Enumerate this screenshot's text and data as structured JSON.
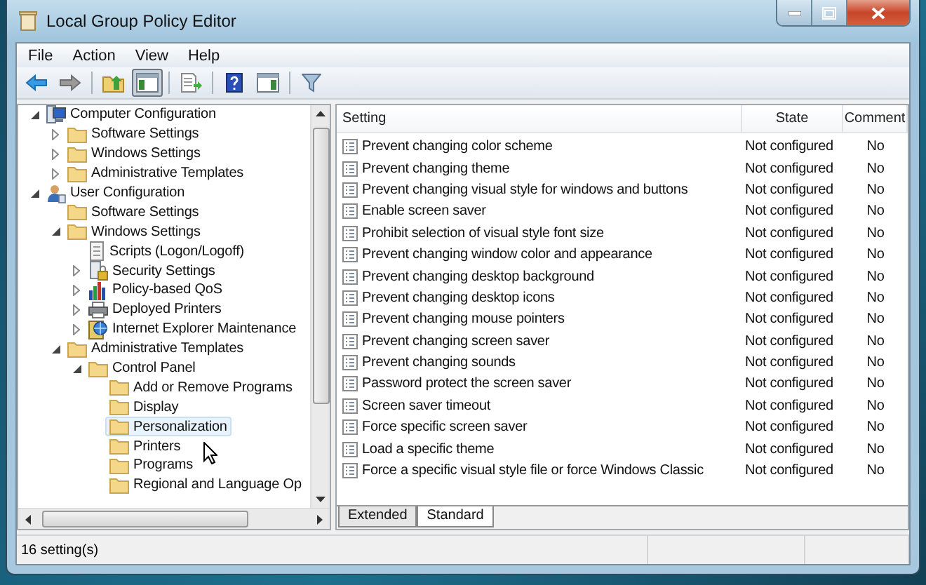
{
  "window": {
    "title": "Local Group Policy Editor"
  },
  "menu": [
    "File",
    "Action",
    "View",
    "Help"
  ],
  "toolbar": [
    {
      "kind": "back",
      "pressed": false
    },
    {
      "kind": "forward",
      "pressed": false
    },
    {
      "kind": "sep"
    },
    {
      "kind": "up",
      "pressed": false
    },
    {
      "kind": "tree",
      "pressed": true
    },
    {
      "kind": "sep"
    },
    {
      "kind": "export",
      "pressed": false
    },
    {
      "kind": "sep"
    },
    {
      "kind": "help",
      "pressed": false
    },
    {
      "kind": "pane",
      "pressed": false
    },
    {
      "kind": "sep"
    },
    {
      "kind": "filter",
      "pressed": false
    }
  ],
  "tree": [
    {
      "label": "Computer Configuration",
      "kind": "computer",
      "expanded": true,
      "selected": false,
      "children": [
        {
          "label": "Software Settings",
          "kind": "folder",
          "expanded": false,
          "selected": false
        },
        {
          "label": "Windows Settings",
          "kind": "folder",
          "expanded": false,
          "selected": false
        },
        {
          "label": "Administrative Templates",
          "kind": "folder",
          "expanded": false,
          "selected": false
        }
      ]
    },
    {
      "label": "User Configuration",
      "kind": "user",
      "expanded": true,
      "selected": false,
      "children": [
        {
          "label": "Software Settings",
          "kind": "folder",
          "selected": false
        },
        {
          "label": "Windows Settings",
          "kind": "folder",
          "expanded": true,
          "selected": false,
          "children": [
            {
              "label": "Scripts (Logon/Logoff)",
              "kind": "script",
              "selected": false
            },
            {
              "label": "Security Settings",
              "kind": "security",
              "expanded": false,
              "selected": false
            },
            {
              "label": "Policy-based QoS",
              "kind": "chart",
              "expanded": false,
              "selected": false
            },
            {
              "label": "Deployed Printers",
              "kind": "printer",
              "expanded": false,
              "selected": false
            },
            {
              "label": "Internet Explorer Maintenance",
              "kind": "ie",
              "expanded": false,
              "selected": false
            }
          ]
        },
        {
          "label": "Administrative Templates",
          "kind": "folder",
          "expanded": true,
          "selected": false,
          "children": [
            {
              "label": "Control Panel",
              "kind": "folder",
              "expanded": true,
              "selected": false,
              "children": [
                {
                  "label": "Add or Remove Programs",
                  "kind": "folder",
                  "selected": false
                },
                {
                  "label": "Display",
                  "kind": "folder",
                  "selected": false
                },
                {
                  "label": "Personalization",
                  "kind": "folder",
                  "selected": true
                },
                {
                  "label": "Printers",
                  "kind": "folder",
                  "selected": false
                },
                {
                  "label": "Programs",
                  "kind": "folder",
                  "selected": false
                },
                {
                  "label": "Regional and Language Op",
                  "kind": "folder",
                  "selected": false
                }
              ]
            }
          ]
        }
      ]
    }
  ],
  "table": {
    "columns": [
      "Setting",
      "State",
      "Comment"
    ],
    "rows": [
      {
        "setting": "Prevent changing color scheme",
        "state": "Not configured",
        "comment": "No"
      },
      {
        "setting": "Prevent changing theme",
        "state": "Not configured",
        "comment": "No"
      },
      {
        "setting": "Prevent changing visual style for windows and buttons",
        "state": "Not configured",
        "comment": "No"
      },
      {
        "setting": "Enable screen saver",
        "state": "Not configured",
        "comment": "No"
      },
      {
        "setting": "Prohibit selection of visual style font size",
        "state": "Not configured",
        "comment": "No"
      },
      {
        "setting": "Prevent changing window color and appearance",
        "state": "Not configured",
        "comment": "No"
      },
      {
        "setting": "Prevent changing desktop background",
        "state": "Not configured",
        "comment": "No"
      },
      {
        "setting": "Prevent changing desktop icons",
        "state": "Not configured",
        "comment": "No"
      },
      {
        "setting": "Prevent changing mouse pointers",
        "state": "Not configured",
        "comment": "No"
      },
      {
        "setting": "Prevent changing screen saver",
        "state": "Not configured",
        "comment": "No"
      },
      {
        "setting": "Prevent changing sounds",
        "state": "Not configured",
        "comment": "No"
      },
      {
        "setting": "Password protect the screen saver",
        "state": "Not configured",
        "comment": "No"
      },
      {
        "setting": "Screen saver timeout",
        "state": "Not configured",
        "comment": "No"
      },
      {
        "setting": "Force specific screen saver",
        "state": "Not configured",
        "comment": "No"
      },
      {
        "setting": "Load a specific theme",
        "state": "Not configured",
        "comment": "No"
      },
      {
        "setting": "Force a specific visual style file or force Windows Classic",
        "state": "Not configured",
        "comment": "No"
      }
    ]
  },
  "tabs": [
    {
      "label": "Extended",
      "selected": false
    },
    {
      "label": "Standard",
      "selected": true
    }
  ],
  "status_bar": "16 setting(s)"
}
